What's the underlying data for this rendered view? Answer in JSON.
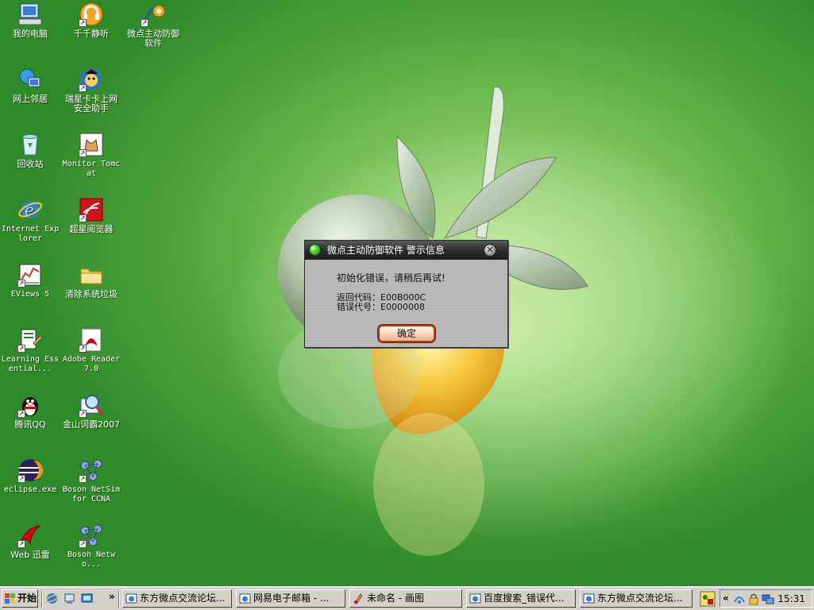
{
  "desktop": {
    "icons": [
      {
        "label": "我的电脑"
      },
      {
        "label": "千千静听"
      },
      {
        "label": "微点主动防御软件"
      },
      {
        "label": "网上邻居"
      },
      {
        "label": "瑞星卡卡上网安全助手"
      },
      {
        "label": "回收站"
      },
      {
        "label": "Monitor Tomcat"
      },
      {
        "label": "Internet Explorer"
      },
      {
        "label": "超星阅览器"
      },
      {
        "label": "EViews 5"
      },
      {
        "label": "清除系统垃圾"
      },
      {
        "label": "Learning Essential..."
      },
      {
        "label": "Adobe Reader 7.0"
      },
      {
        "label": "腾讯QQ"
      },
      {
        "label": "金山词霸2007"
      },
      {
        "label": "eclipse.exe"
      },
      {
        "label": "Boson NetSim for CCNA"
      },
      {
        "label": "Web 迅雷"
      },
      {
        "label": "Boson Netwo..."
      }
    ]
  },
  "dialog": {
    "title": "微点主动防御软件  警示信息",
    "message": "初始化错误，请稍后再试!",
    "return_code": "返回代码：E00B000C",
    "error_code": "错误代号：E0000008",
    "ok_label": "确定",
    "close_glyph": "✕"
  },
  "taskbar": {
    "start_label": "开始",
    "chevron": "»",
    "buttons": [
      {
        "label": "东方微点交流论坛..."
      },
      {
        "label": "网易电子邮箱 - ..."
      },
      {
        "label": "未命名 - 画图"
      },
      {
        "label": "百度搜索_错误代..."
      },
      {
        "label": "东方微点交流论坛..."
      }
    ],
    "tray": {
      "chevron": "«",
      "clock": "15:31"
    }
  },
  "colors": {
    "wallpaper_green": "#4fa63a",
    "dialog_title": "#2d2d2d",
    "ok_border": "#b83a14",
    "taskbar": "#d4d0c8"
  }
}
